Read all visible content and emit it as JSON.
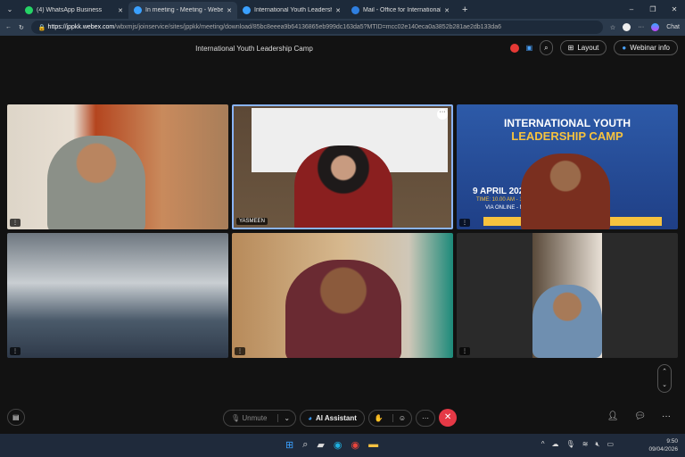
{
  "browser": {
    "tabs": [
      {
        "label": "(4) WhatsApp Business",
        "color": "#25d366"
      },
      {
        "label": "In meeting - Meeting - Webex",
        "color": "#3aa0ff",
        "active": true
      },
      {
        "label": "International Youth Leadership Ca",
        "color": "#3aa0ff"
      },
      {
        "label": "Mail - Office for International Affa",
        "color": "#2f7fe0"
      }
    ],
    "url_domain": "https://jppkk.webex.com",
    "url_path": "/wbxmjs/joinservice/sites/jppkk/meeting/download/85bc8eeea9b64136865eb999dc163da5?MTID=mcc02e140eca0a3852b281ae2db133da6",
    "chat_label": "Chat"
  },
  "meeting": {
    "title": "International Youth Leadership Camp",
    "layout_label": "Layout",
    "webinar_info_label": "Webinar info",
    "participants": [
      {
        "name": ""
      },
      {
        "name": "YASMEEN"
      },
      {
        "name": ""
      },
      {
        "name": ""
      },
      {
        "name": ""
      },
      {
        "name": ""
      }
    ],
    "banner": {
      "line1": "INTERNATIONAL YOUTH",
      "line2": "LEADERSHIP CAMP",
      "date": "9 APRIL 2026",
      "time": "TIME: 10.00 AM - 12",
      "via": "VIA ONLINE - M",
      "footer": "CO          LEAD"
    },
    "controls": {
      "unmute": "Unmute",
      "ai_assistant": "AI Assistant"
    }
  },
  "taskbar": {
    "time": "9:50",
    "date": "09/04/2026"
  }
}
